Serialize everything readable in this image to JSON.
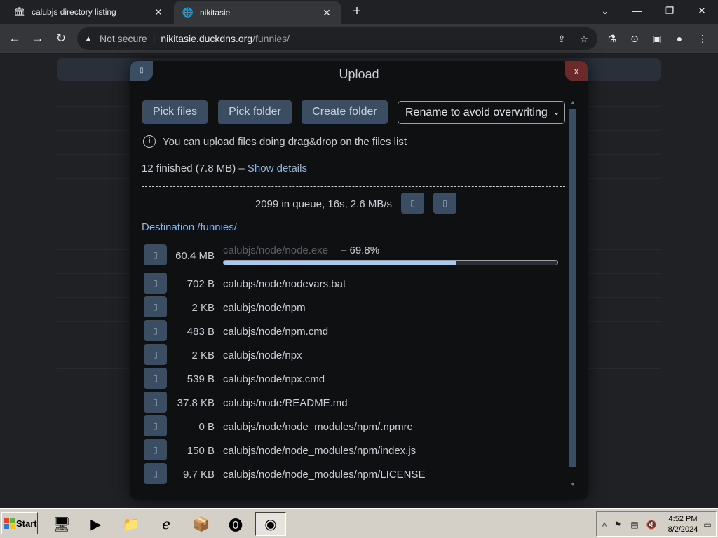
{
  "browser": {
    "tabs": [
      {
        "title": "calubjs directory listing",
        "icon": "library-icon"
      },
      {
        "title": "nikitasie",
        "icon": "globe-icon"
      }
    ],
    "address": {
      "security": "Not secure",
      "host": "nikitasie.duckdns.org",
      "path": "/funnies/"
    }
  },
  "modal": {
    "title": "Upload",
    "close_label": "x",
    "buttons": {
      "pick_files": "Pick files",
      "pick_folder": "Pick folder",
      "create_folder": "Create folder"
    },
    "conflict_mode": "Rename to avoid overwriting",
    "info_text": "You can upload files doing drag&drop on the files list",
    "finished_text": "12 finished (7.8 MB) –",
    "show_details": "Show details",
    "queue_text": "2099 in queue, 16s, 2.6 MB/s",
    "destination": "Destination /funnies/",
    "active_file": {
      "size": "60.4 MB",
      "name": "calubjs/node/node.exe",
      "percent_text": "– 69.8%",
      "progress": 69.8
    },
    "files": [
      {
        "size": "702 B",
        "name": "calubjs/node/nodevars.bat"
      },
      {
        "size": "2 KB",
        "name": "calubjs/node/npm"
      },
      {
        "size": "483 B",
        "name": "calubjs/node/npm.cmd"
      },
      {
        "size": "2 KB",
        "name": "calubjs/node/npx"
      },
      {
        "size": "539 B",
        "name": "calubjs/node/npx.cmd"
      },
      {
        "size": "37.8 KB",
        "name": "calubjs/node/README.md"
      },
      {
        "size": "0 B",
        "name": "calubjs/node/node_modules/npm/.npmrc"
      },
      {
        "size": "150 B",
        "name": "calubjs/node/node_modules/npm/index.js"
      },
      {
        "size": "9.7 KB",
        "name": "calubjs/node/node_modules/npm/LICENSE"
      }
    ]
  },
  "taskbar": {
    "start_label": "Start",
    "clock_time": "4:52 PM",
    "clock_date": "8/2/2024"
  }
}
